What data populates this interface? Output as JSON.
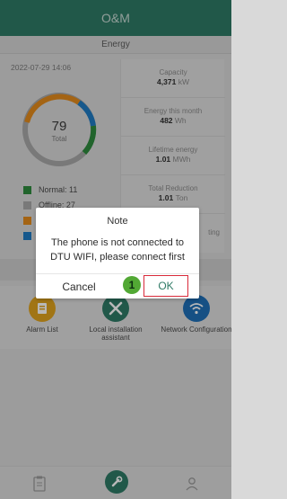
{
  "header": {
    "title": "O&M"
  },
  "tabs": {
    "active": "Energy"
  },
  "overview": {
    "datetime": "2022-07-29 14:06",
    "total_value": "79",
    "total_label": "Total",
    "legend": [
      {
        "label": "Normal: 11",
        "color": "#2e8b3e"
      },
      {
        "label": "Offline: 27",
        "color": "#a8a8a8"
      },
      {
        "label": "",
        "color": "#e38b1d"
      },
      {
        "label": "",
        "color": "#1f7bc2"
      }
    ]
  },
  "metrics": [
    {
      "label": "Capacity",
      "value": "4,371",
      "unit": "kW"
    },
    {
      "label": "Energy this month",
      "value": "482",
      "unit": "Wh"
    },
    {
      "label": "Lifetime energy",
      "value": "1.01",
      "unit": "MWh"
    },
    {
      "label": "Total Reduction",
      "value": "1.01",
      "unit": "Ton"
    },
    {
      "label": "ting",
      "value": "",
      "unit": ""
    }
  ],
  "tools": [
    {
      "label": "Alarm List",
      "icon": "alarm-list-icon"
    },
    {
      "label": "Local installation assistant",
      "icon": "tools-icon"
    },
    {
      "label": "Network Configuration",
      "icon": "wifi-icon"
    }
  ],
  "dialog": {
    "title": "Note",
    "message": "The phone is not connected to DTU WIFI, please connect first",
    "cancel_label": "Cancel",
    "ok_label": "OK",
    "step_badge": "1"
  },
  "bottom_nav": [
    {
      "name": "clipboard-icon"
    },
    {
      "name": "wrench-icon"
    },
    {
      "name": "user-icon"
    }
  ],
  "colors": {
    "brand": "#2f7a66",
    "highlight": "#d92a3a",
    "badge": "#52a834"
  }
}
